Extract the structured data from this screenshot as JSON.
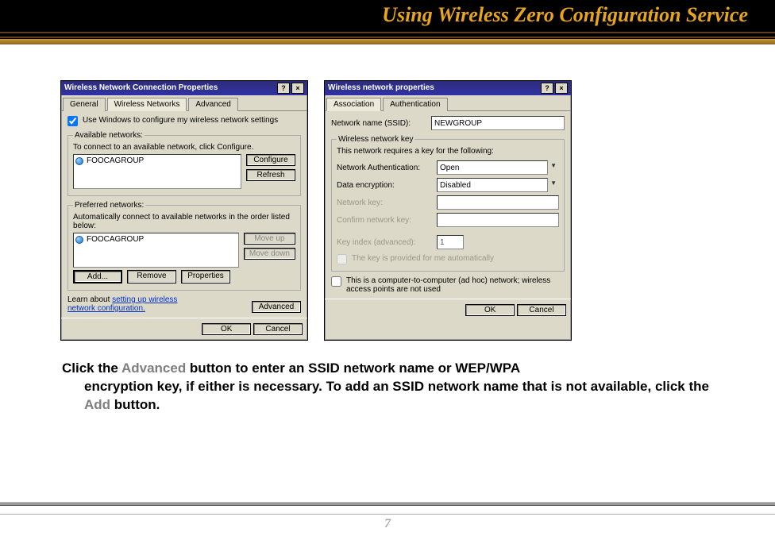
{
  "banner": {
    "title": "Using Wireless Zero Configuration Service"
  },
  "dlg1": {
    "title": "Wireless Network Connection Properties",
    "tabs": {
      "general": "General",
      "wireless": "Wireless Networks",
      "advanced": "Advanced"
    },
    "use_windows": "Use Windows to configure my wireless network settings",
    "available": {
      "legend": "Available networks:",
      "hint": "To connect to an available network, click Configure.",
      "item": "FOOCAGROUP",
      "configure": "Configure",
      "refresh": "Refresh"
    },
    "preferred": {
      "legend": "Preferred networks:",
      "hint": "Automatically connect to available networks in the order listed below:",
      "item": "FOOCAGROUP",
      "moveup": "Move up",
      "movedown": "Move down",
      "add": "Add...",
      "remove": "Remove",
      "properties": "Properties"
    },
    "learn_pre": "Learn about ",
    "learn_link": "setting up wireless network configuration.",
    "advanced_btn": "Advanced",
    "ok": "OK",
    "cancel": "Cancel"
  },
  "dlg2": {
    "title": "Wireless network properties",
    "tabs": {
      "assoc": "Association",
      "auth": "Authentication"
    },
    "ssid_label": "Network name (SSID):",
    "ssid_value": "NEWGROUP",
    "key_legend": "Wireless network key",
    "key_hint": "This network requires a key for the following:",
    "auth_label": "Network Authentication:",
    "auth_value": "Open",
    "enc_label": "Data encryption:",
    "enc_value": "Disabled",
    "netkey_label": "Network key:",
    "cnetkey_label": "Confirm network key:",
    "kidx_label": "Key index (advanced):",
    "kidx_value": "1",
    "auto_key": "The key is provided for me automatically",
    "adhoc": "This is a computer-to-computer (ad hoc) network; wireless access points are not used",
    "ok": "OK",
    "cancel": "Cancel"
  },
  "instruction": {
    "p1a": "Click the ",
    "p1b": "Advanced",
    "p1c": " button to enter an SSID network name or WEP/WPA",
    "p2a": "encryption key, if either is necessary.  To add an SSID network name that is not available, click the ",
    "p2b": "Add",
    "p2c": " button."
  },
  "page_number": "7"
}
